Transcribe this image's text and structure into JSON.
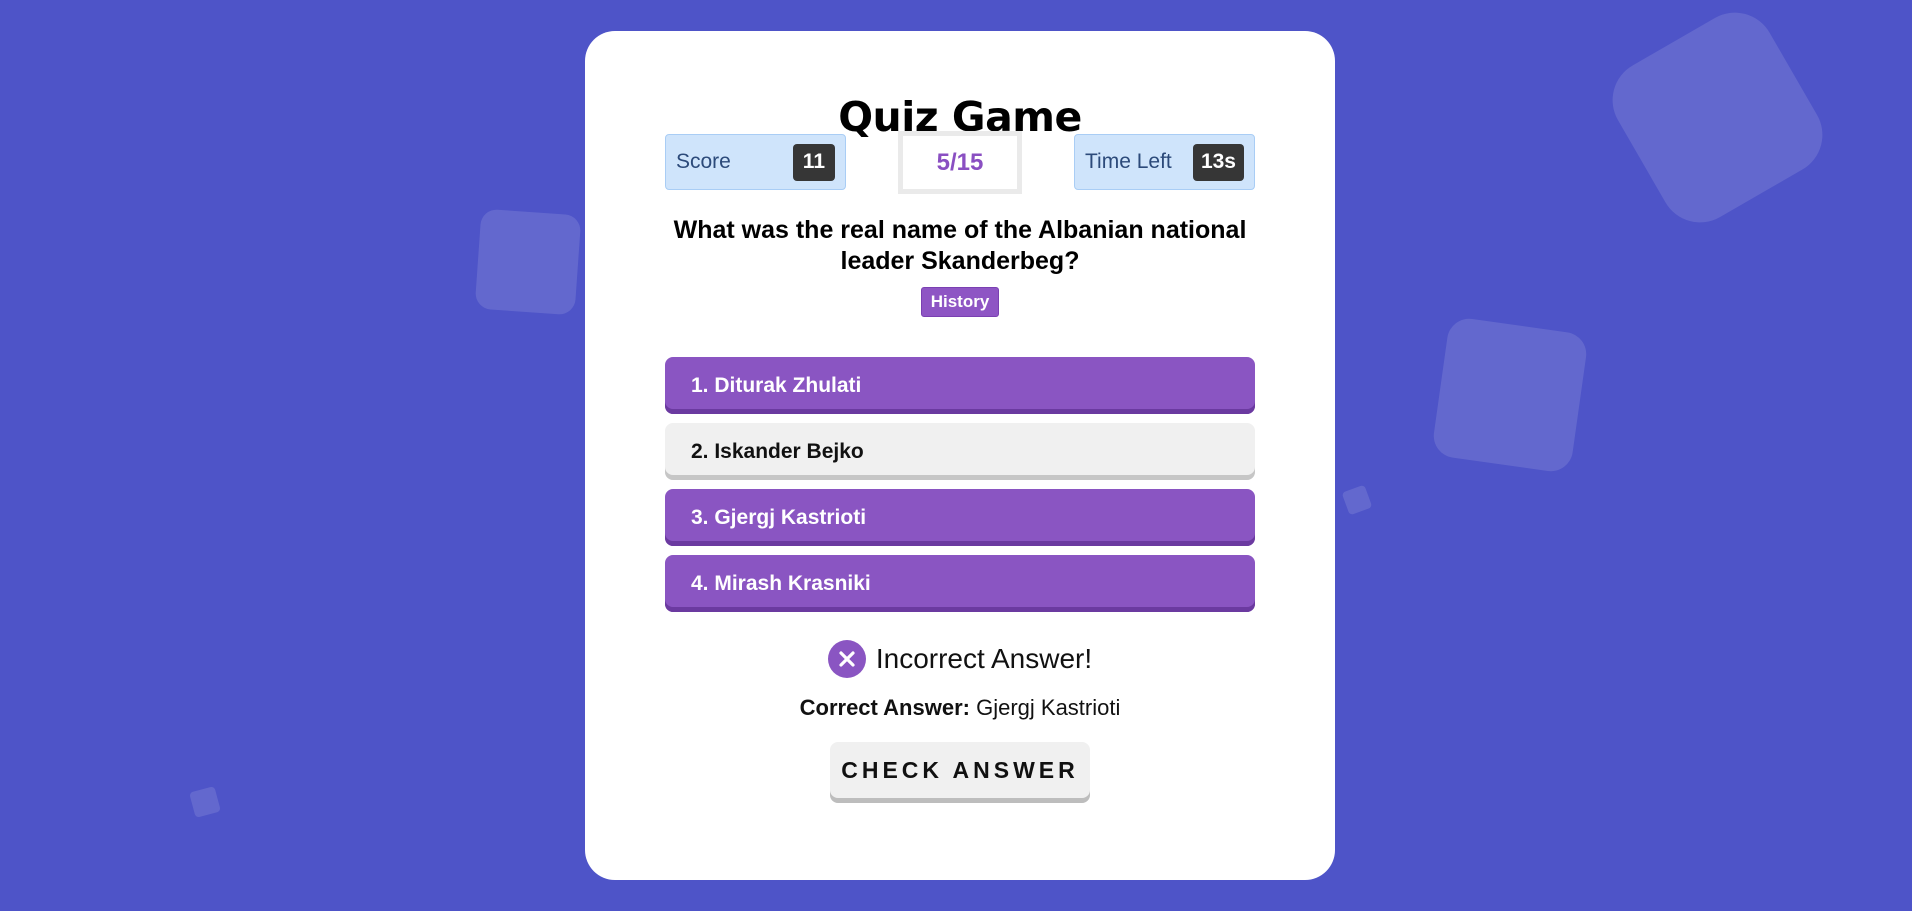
{
  "app": {
    "title": "Quiz Game"
  },
  "stats": {
    "score_label": "Score",
    "score_value": "11",
    "progress": "5/15",
    "time_label": "Time Left",
    "time_value": "13s"
  },
  "question": {
    "text": "What was the real name of the Albanian national leader Skanderbeg?",
    "category": "History"
  },
  "options": [
    {
      "label": "1. Diturak Zhulati",
      "state": "wrong"
    },
    {
      "label": "2. Iskander Bejko",
      "state": "neutral"
    },
    {
      "label": "3. Gjergj Kastrioti",
      "state": "wrong"
    },
    {
      "label": "4. Mirash Krasniki",
      "state": "wrong"
    }
  ],
  "result": {
    "icon": "close-icon",
    "message": "Incorrect Answer!",
    "correct_label": "Correct Answer:",
    "correct_value": "Gjergj Kastrioti"
  },
  "actions": {
    "check_label": "CHECK ANSWER"
  },
  "colors": {
    "background": "#4e54c8",
    "accent": "#8a55c2",
    "stat_bg": "#cfe4fb",
    "badge_bg": "#363636"
  }
}
